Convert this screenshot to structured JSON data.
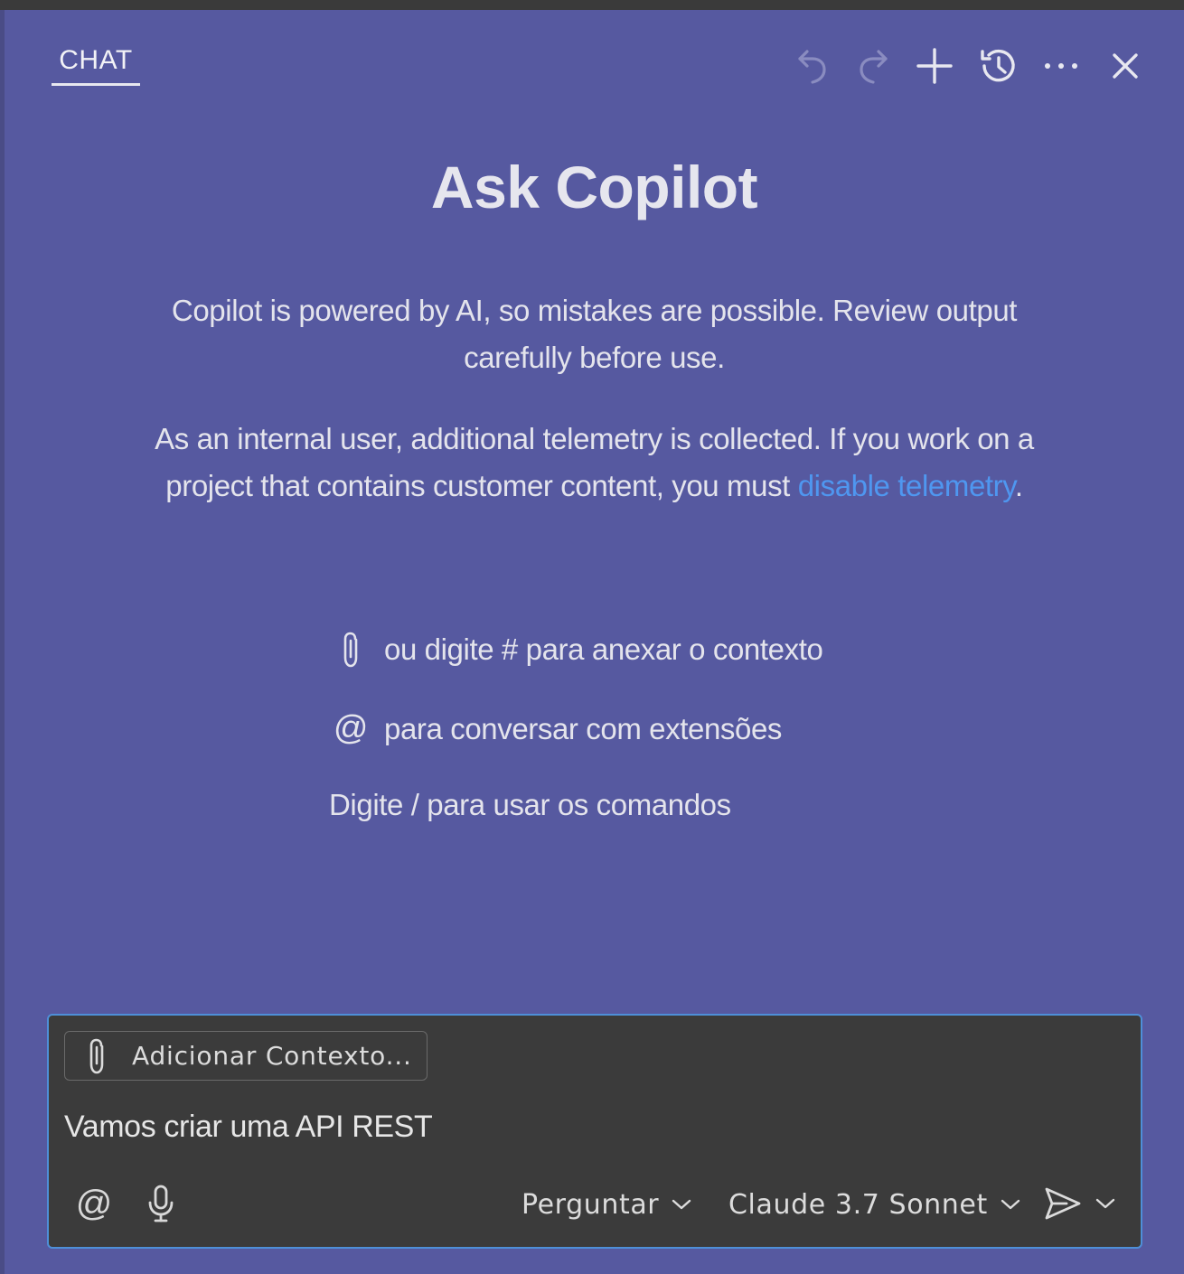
{
  "header": {
    "tab_label": "CHAT",
    "icons": [
      "undo-icon",
      "redo-icon",
      "plus-icon",
      "history-icon",
      "ellipsis-icon",
      "close-icon"
    ]
  },
  "welcome": {
    "title": "Ask Copilot",
    "disclaimer": "Copilot is powered by AI, so mistakes are possible. Review output carefully before use.",
    "telemetry_prefix": "As an internal user, additional telemetry is collected. If you work on a project that contains customer content, you must ",
    "telemetry_link": "disable telemetry",
    "telemetry_suffix": ".",
    "hints": {
      "attach": "ou digite # para anexar o contexto",
      "extensions": "para conversar com extensões",
      "commands": "Digite / para usar os comandos"
    }
  },
  "input": {
    "context_button": "Adicionar Contexto...",
    "value": "Vamos criar uma API REST",
    "mode": "Perguntar",
    "model": "Claude 3.7 Sonnet"
  },
  "colors": {
    "panel_bg": "#5659a0",
    "input_bg": "#3b3b3b",
    "focus_border": "#4e8fd8",
    "link": "#4f97f0"
  }
}
